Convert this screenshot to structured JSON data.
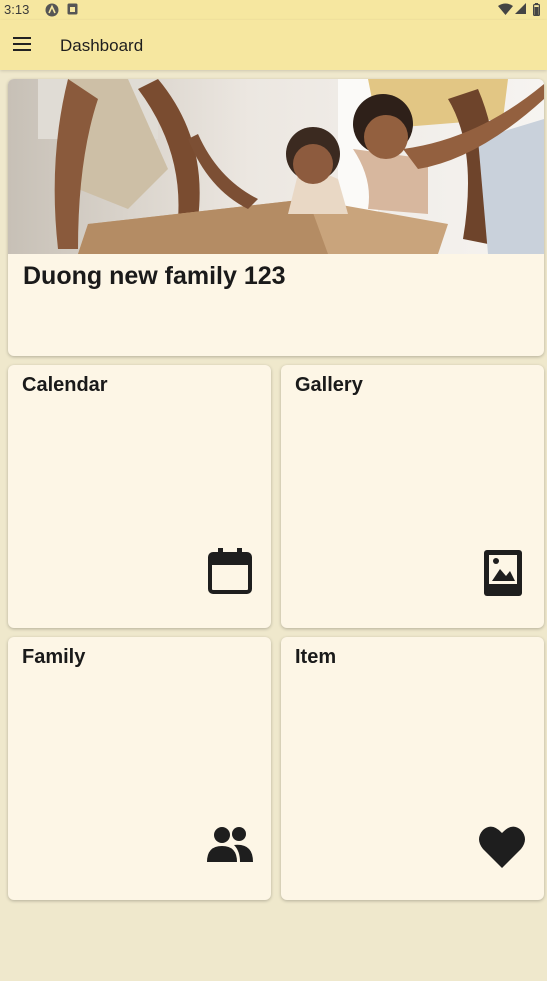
{
  "status_bar": {
    "time": "3:13"
  },
  "app_bar": {
    "title": "Dashboard"
  },
  "family": {
    "name": "Duong new family 123"
  },
  "tiles": [
    {
      "label": "Calendar",
      "icon": "calendar-icon"
    },
    {
      "label": "Gallery",
      "icon": "image-icon"
    },
    {
      "label": "Family",
      "icon": "people-icon"
    },
    {
      "label": "Item",
      "icon": "heart-icon"
    }
  ],
  "colors": {
    "app_bar": "#f6e7a0",
    "background": "#efe8cc",
    "card": "#fdf6e6",
    "icon": "#1e1e1e"
  }
}
